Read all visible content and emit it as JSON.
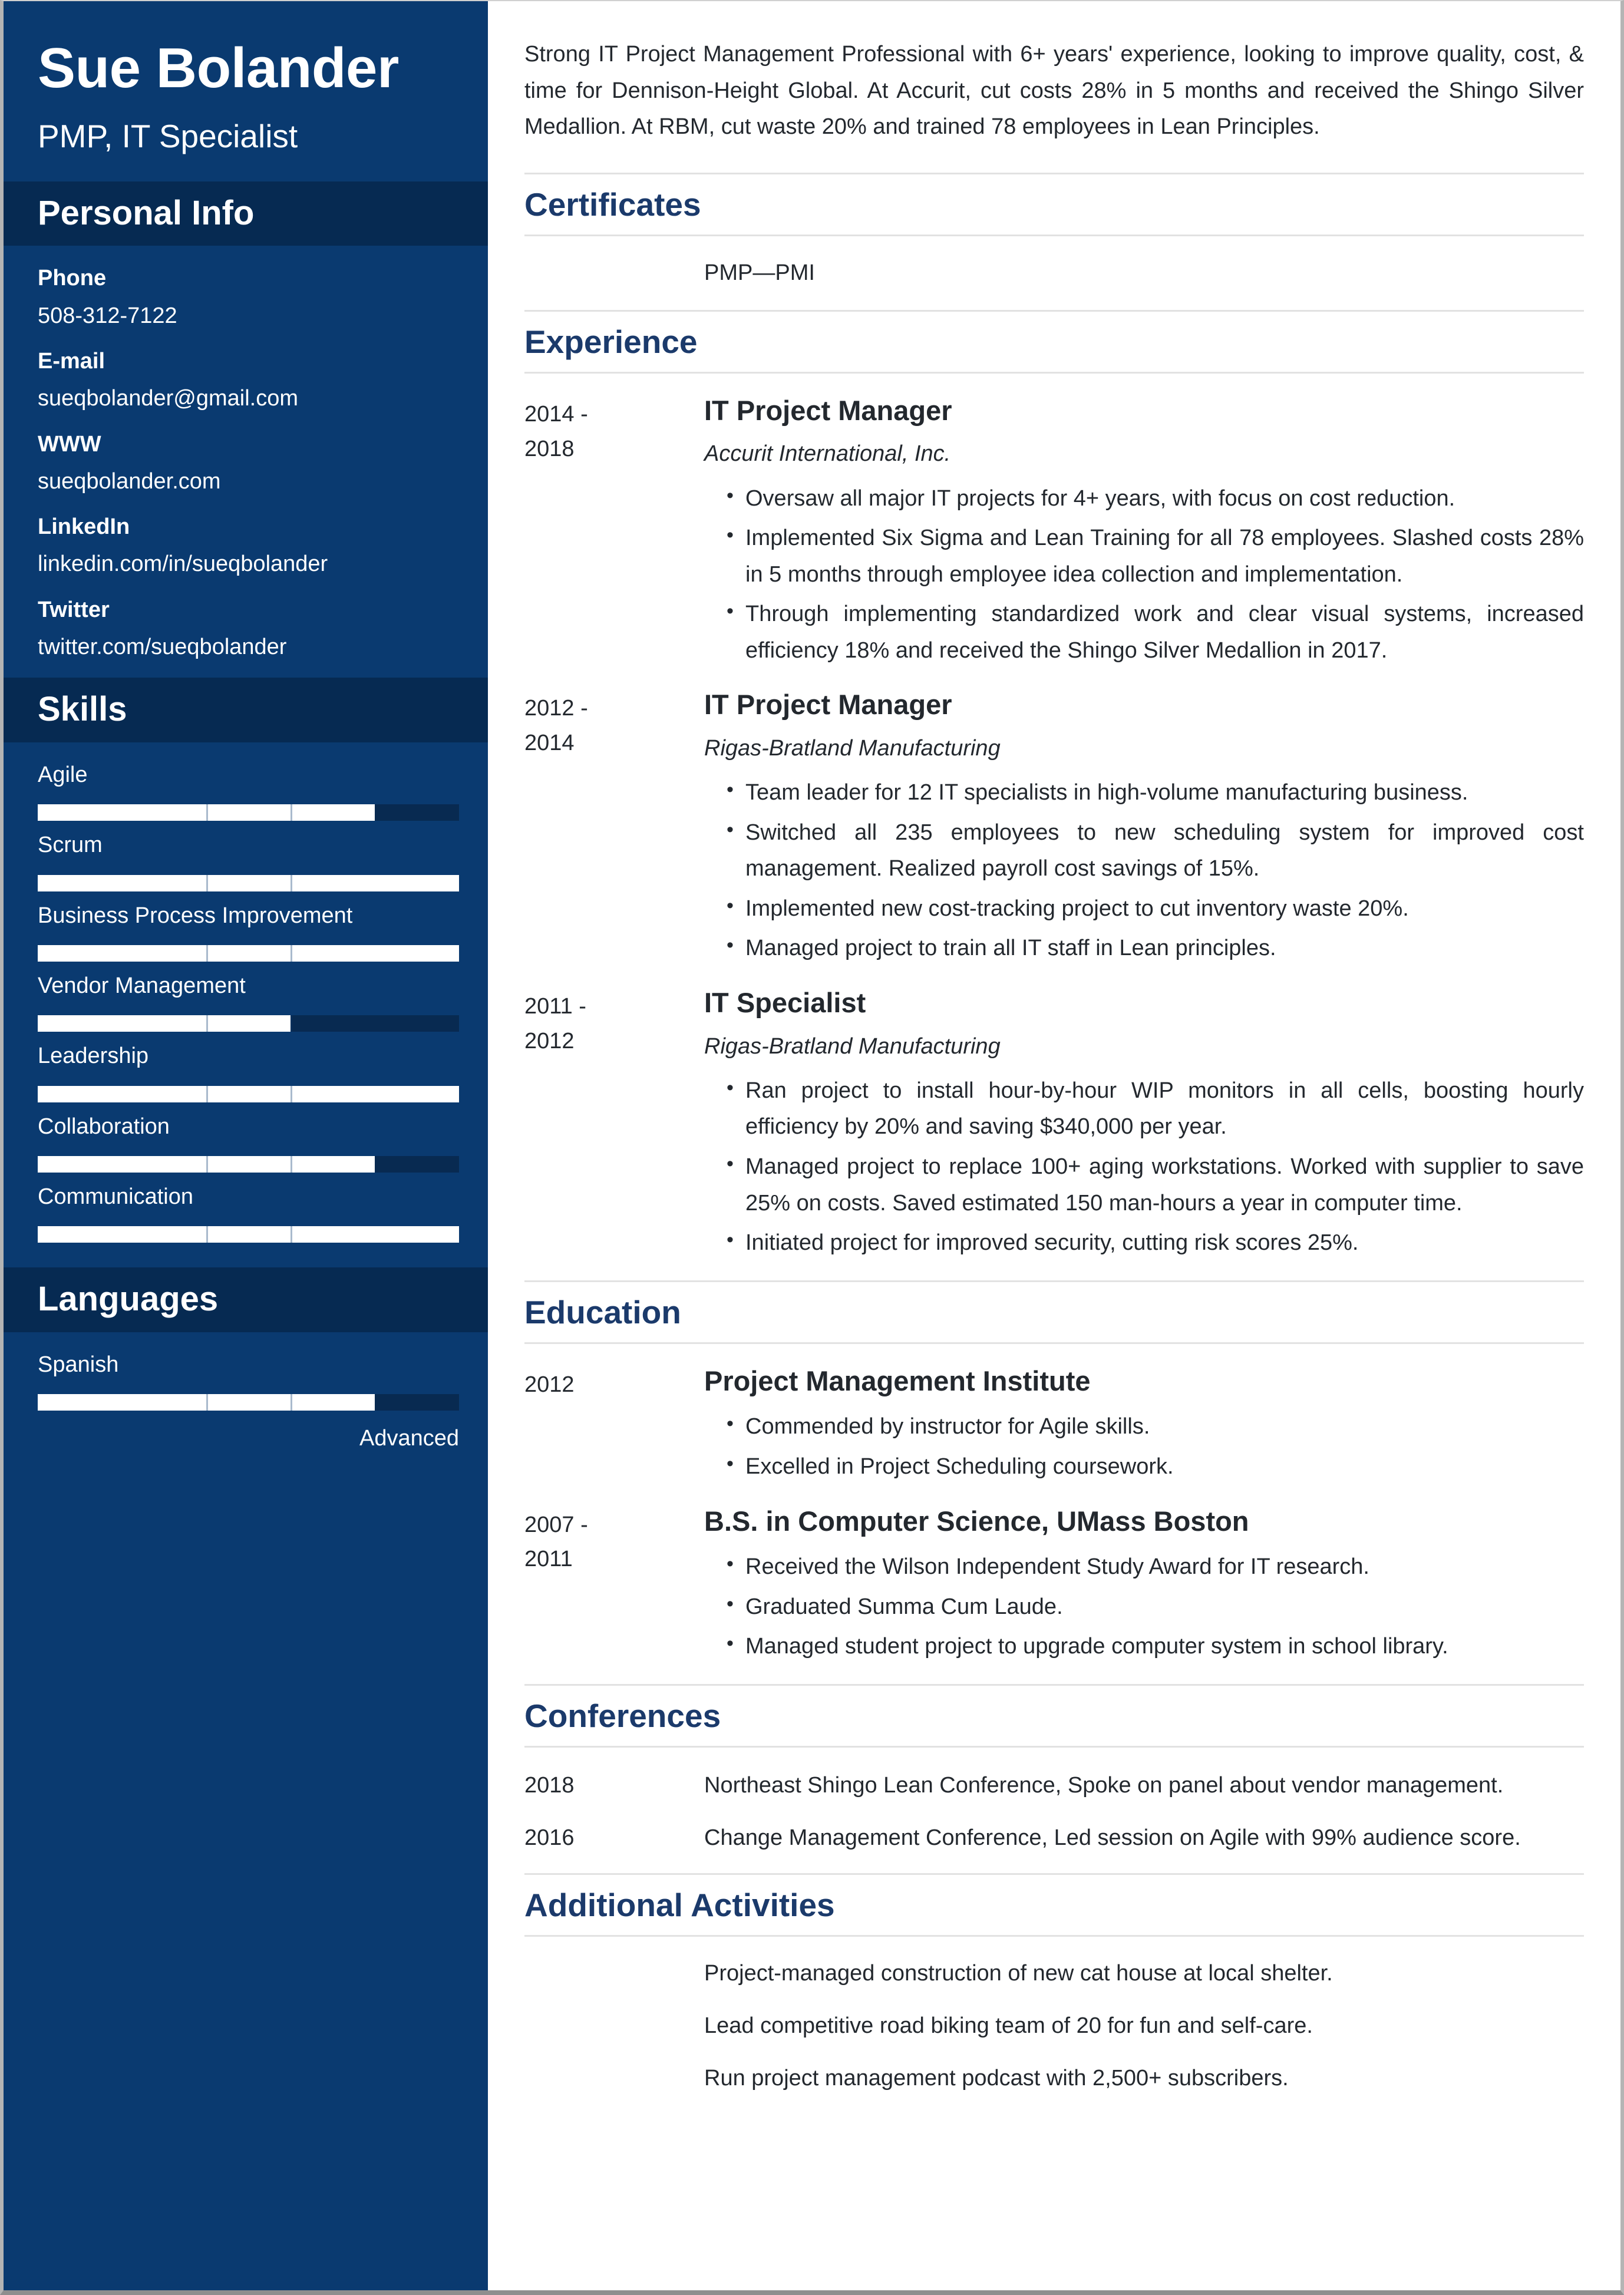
{
  "colors": {
    "sidebar_bg": "#0a3a70",
    "sidebar_header_bg": "#062a52",
    "heading_navy": "#1b3a6b",
    "body_text": "#23282e",
    "rule": "#e2e2e2",
    "bar_empty": "#082a51",
    "bar_fill": "#ffffff"
  },
  "sidebar": {
    "name": "Sue Bolander",
    "job_title": "PMP, IT Specialist",
    "personal_info": {
      "heading": "Personal Info",
      "items": [
        {
          "label": "Phone",
          "value": "508-312-7122"
        },
        {
          "label": "E-mail",
          "value": "sueqbolander@gmail.com"
        },
        {
          "label": "WWW",
          "value": "sueqbolander.com"
        },
        {
          "label": "LinkedIn",
          "value": "linkedin.com/in/sueqbolander"
        },
        {
          "label": "Twitter",
          "value": "twitter.com/sueqbolander"
        }
      ]
    },
    "skills": {
      "heading": "Skills",
      "items": [
        {
          "label": "Agile",
          "level": 80
        },
        {
          "label": "Scrum",
          "level": 100
        },
        {
          "label": "Business Process Improvement",
          "level": 100
        },
        {
          "label": "Vendor Management",
          "level": 60
        },
        {
          "label": "Leadership",
          "level": 100
        },
        {
          "label": "Collaboration",
          "level": 80
        },
        {
          "label": "Communication",
          "level": 100
        }
      ]
    },
    "languages": {
      "heading": "Languages",
      "items": [
        {
          "label": "Spanish",
          "level": 80,
          "level_label": "Advanced"
        }
      ]
    }
  },
  "main": {
    "summary": "Strong IT Project Management Professional with 6+ years' experience, looking to improve quality, cost, & time for Dennison-Height Global. At Accurit, cut costs 28% in 5 months and received the Shingo Silver Medallion. At RBM, cut waste 20% and trained 78 employees in Lean Principles.",
    "certificates": {
      "heading": "Certificates",
      "items": [
        {
          "text": "PMP—PMI"
        }
      ]
    },
    "experience": {
      "heading": "Experience",
      "entries": [
        {
          "date_start": "2014 -",
          "date_end": "2018",
          "role": "IT Project Manager",
          "org": "Accurit International, Inc.",
          "bullets": [
            "Oversaw all major IT projects for 4+ years, with focus on cost reduction.",
            "Implemented Six Sigma and Lean Training for all 78 employees. Slashed costs 28% in 5 months through employee idea collection and implementation.",
            "Through implementing standardized work and clear visual systems, increased efficiency 18% and received the Shingo Silver Medallion in 2017."
          ]
        },
        {
          "date_start": "2012 -",
          "date_end": "2014",
          "role": "IT Project Manager",
          "org": "Rigas-Bratland Manufacturing",
          "bullets": [
            "Team leader for 12 IT specialists in high-volume manufacturing business.",
            "Switched all 235 employees to new scheduling system for improved cost management. Realized payroll cost savings of 15%.",
            "Implemented new cost-tracking project to cut inventory waste 20%.",
            "Managed project to train all IT staff in Lean principles."
          ]
        },
        {
          "date_start": "2011 -",
          "date_end": "2012",
          "role": "IT Specialist",
          "org": "Rigas-Bratland Manufacturing",
          "bullets": [
            "Ran project to install hour-by-hour WIP monitors in all cells, boosting hourly efficiency by 20% and saving $340,000 per year.",
            "Managed project to replace 100+ aging workstations. Worked with supplier to save 25% on costs. Saved estimated 150 man-hours a year in computer time.",
            "Initiated project for improved security, cutting risk scores 25%."
          ]
        }
      ]
    },
    "education": {
      "heading": "Education",
      "entries": [
        {
          "date_start": "2012",
          "date_end": "",
          "role": "Project Management Institute",
          "org": "",
          "bullets": [
            "Commended by instructor for Agile skills.",
            "Excelled in Project Scheduling coursework."
          ]
        },
        {
          "date_start": "2007 -",
          "date_end": "2011",
          "role": "B.S. in Computer Science, UMass Boston",
          "org": "",
          "bullets": [
            "Received the Wilson Independent Study Award for IT research.",
            "Graduated Summa Cum Laude.",
            "Managed student project to upgrade computer system in school library."
          ]
        }
      ]
    },
    "conferences": {
      "heading": "Conferences",
      "entries": [
        {
          "date": "2018",
          "text": "Northeast Shingo Lean Conference, Spoke on panel about vendor management."
        },
        {
          "date": "2016",
          "text": "Change Management Conference, Led session on Agile with 99% audience score."
        }
      ]
    },
    "additional_activities": {
      "heading": "Additional Activities",
      "items": [
        {
          "text": "Project-managed construction of new cat house at local shelter."
        },
        {
          "text": "Lead competitive road biking team of 20 for fun and self-care."
        },
        {
          "text": "Run project management podcast with 2,500+ subscribers."
        }
      ]
    }
  }
}
